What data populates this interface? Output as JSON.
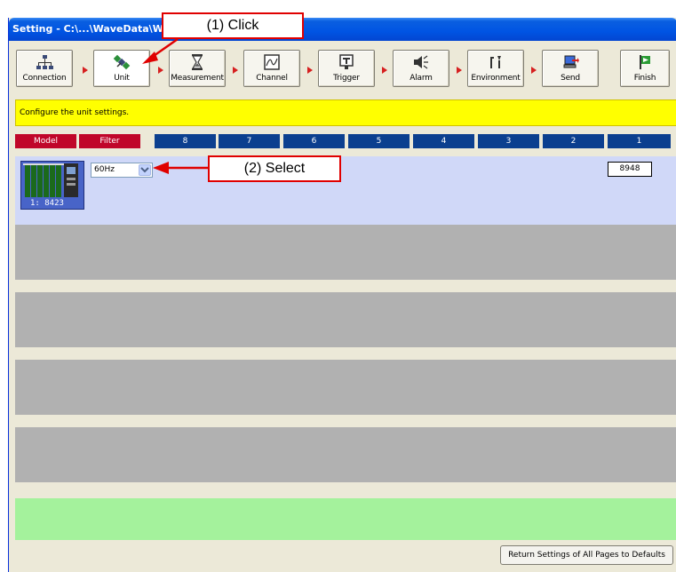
{
  "window": {
    "title": "Setting - C:\\...\\WaveData\\WAV"
  },
  "toolbar": {
    "buttons": [
      {
        "label": "Connection",
        "icon": "network-icon"
      },
      {
        "label": "Unit",
        "icon": "satellite-icon"
      },
      {
        "label": "Measurement",
        "icon": "hourglass-icon"
      },
      {
        "label": "Channel",
        "icon": "waveform-icon"
      },
      {
        "label": "Trigger",
        "icon": "trigger-icon"
      },
      {
        "label": "Alarm",
        "icon": "speaker-icon"
      },
      {
        "label": "Environment",
        "icon": "tools-icon"
      },
      {
        "label": "Send",
        "icon": "computer-send-icon"
      },
      {
        "label": "Finish",
        "icon": "finish-flag-icon"
      }
    ],
    "active": "Unit"
  },
  "info": {
    "message": "Configure the unit settings."
  },
  "tabs": [
    "Model",
    "Filter",
    "8",
    "7",
    "6",
    "5",
    "4",
    "3",
    "2",
    "1"
  ],
  "unit": {
    "thumb_label": "1: 8423",
    "filter_value": "60Hz",
    "model_value": "8948"
  },
  "footer": {
    "defaults_button": "Return Settings of All Pages to Defaults"
  },
  "callouts": {
    "click": "(1) Click",
    "select": "(2) Select"
  },
  "colors": {
    "tab_red": "#c0062a",
    "tab_blue": "#0b3f8f",
    "info_yellow": "#ffff00",
    "unit_row": "#d0d8f8",
    "empty_row": "#b1b1b1",
    "green_bar": "#a4f29c",
    "callout_red": "#e00000"
  }
}
